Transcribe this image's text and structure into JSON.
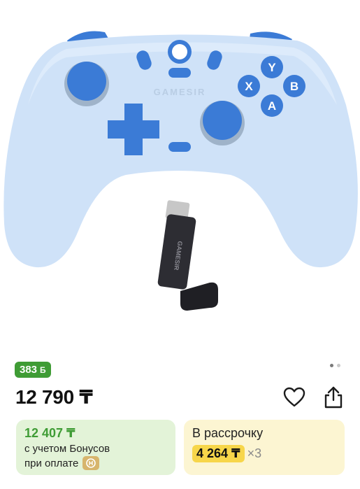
{
  "product": {
    "image_alt": "GameSir gamepad with USB receiver",
    "logo_text": "GAMESIR",
    "dongle_text": "GAMESIR",
    "face_buttons": {
      "y": "Y",
      "x": "X",
      "b": "B",
      "a": "A"
    },
    "gallery": {
      "total": 2,
      "active": 0
    }
  },
  "bonus_badge": {
    "amount": "383",
    "currency_icon": "Б"
  },
  "price": {
    "current": "12 790 ₸"
  },
  "actions": {
    "favorite_icon": "heart-icon",
    "share_icon": "share-icon"
  },
  "bonus_card": {
    "price": "12 407 ₸",
    "line1": "с учетом Бонусов",
    "line2": "при оплате"
  },
  "installment_card": {
    "title": "В рассрочку",
    "amount": "4 264 ₸",
    "multiplier": "×3"
  },
  "colors": {
    "bonus_green": "#3f9c35",
    "bonus_card_bg": "#e3f3d8",
    "installment_bg": "#fcf5d2",
    "installment_highlight": "#f7d64a",
    "controller_body": "#cfe2f8",
    "controller_accent": "#3b7bd6"
  }
}
